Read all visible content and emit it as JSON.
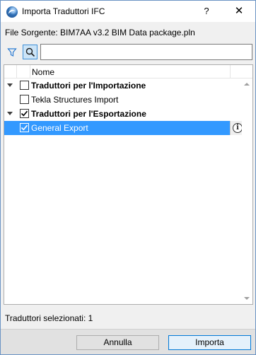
{
  "window": {
    "title": "Importa Traduttori IFC",
    "help_glyph": "?",
    "close_glyph": "✕"
  },
  "source": {
    "text": "File Sorgente: BIM7AA v3.2 BIM Data package.pln"
  },
  "search": {
    "value": "",
    "placeholder": ""
  },
  "list": {
    "column_name": "Nome",
    "rows": [
      {
        "label": "Traduttori per l'Importazione",
        "checked": false,
        "group": true
      },
      {
        "label": "Tekla Structures Import",
        "checked": false,
        "group": false
      },
      {
        "label": "Traduttori per l'Esportazione",
        "checked": true,
        "group": true
      },
      {
        "label": "General Export",
        "checked": true,
        "group": false,
        "selected": true
      }
    ],
    "info_glyph": "i"
  },
  "status": {
    "selected_text": "Traduttori selezionati: 1"
  },
  "buttons": {
    "cancel_label": "Annulla",
    "import_label": "Importa"
  },
  "colors": {
    "selection": "#3399ff",
    "window_border": "#6b93c4",
    "primary_button_border": "#0078d7"
  }
}
